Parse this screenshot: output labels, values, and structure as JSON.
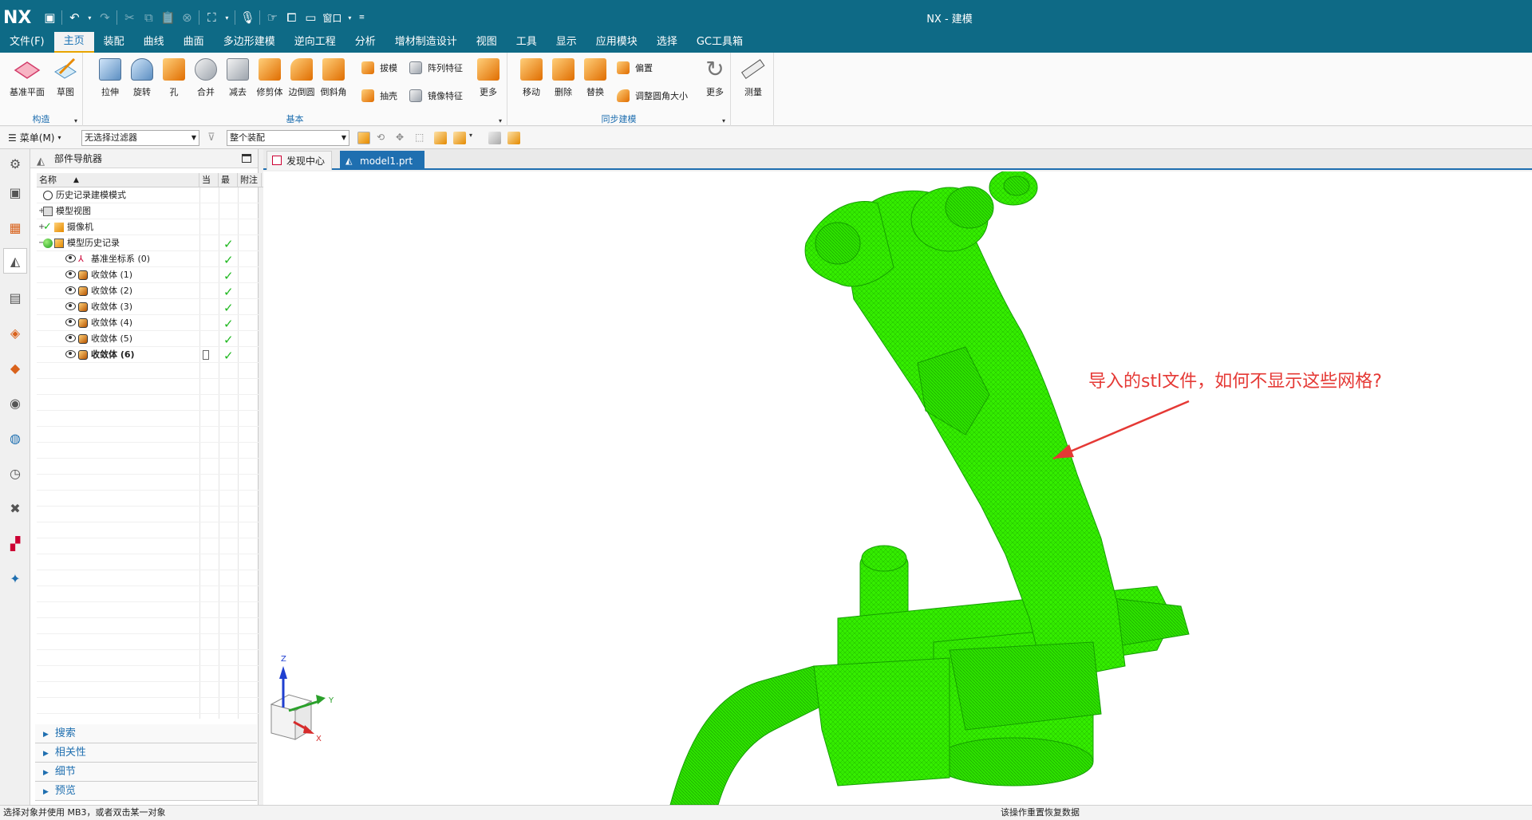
{
  "window": {
    "logo": "NX",
    "title": "NX - 建模",
    "window_menu": "窗口"
  },
  "menubar": {
    "items": [
      "文件(F)",
      "主页",
      "装配",
      "曲线",
      "曲面",
      "多边形建模",
      "逆向工程",
      "分析",
      "增材制造设计",
      "视图",
      "工具",
      "显示",
      "应用模块",
      "选择",
      "GC工具箱"
    ],
    "active_index": 1
  },
  "ribbon": {
    "construct": {
      "label": "构造",
      "buttons": [
        "基准平面",
        "草图"
      ]
    },
    "basic": {
      "label": "基本",
      "big_buttons": [
        "拉伸",
        "旋转",
        "孔",
        "合并",
        "减去",
        "修剪体",
        "边倒圆",
        "倒斜角"
      ],
      "small_buttons": [
        "拔模",
        "阵列特征",
        "抽壳",
        "镜像特征"
      ],
      "more": "更多"
    },
    "sync": {
      "label": "同步建模",
      "big_buttons": [
        "移动",
        "删除",
        "替换"
      ],
      "small_buttons": [
        "偏置",
        "调整圆角大小"
      ],
      "more": "更多"
    },
    "measure": {
      "label": "测量"
    }
  },
  "filterbar": {
    "menu": "菜单(M)",
    "filter": "无选择过滤器",
    "scope": "整个装配"
  },
  "navigator": {
    "title": "部件导航器",
    "columns": [
      "名称",
      "当",
      "最",
      "附注"
    ],
    "rows": [
      {
        "label": "历史记录建模模式",
        "level": 0,
        "check": false,
        "bold": false
      },
      {
        "label": "模型视图",
        "level": 0,
        "check": false,
        "bold": false
      },
      {
        "label": "摄像机",
        "level": 0,
        "check": false,
        "bold": false
      },
      {
        "label": "模型历史记录",
        "level": 0,
        "check": true,
        "bold": false
      },
      {
        "label": "基准坐标系 (0)",
        "level": 1,
        "check": true,
        "bold": false
      },
      {
        "label": "收敛体 (1)",
        "level": 1,
        "check": true,
        "bold": false
      },
      {
        "label": "收敛体 (2)",
        "level": 1,
        "check": true,
        "bold": false
      },
      {
        "label": "收敛体 (3)",
        "level": 1,
        "check": true,
        "bold": false
      },
      {
        "label": "收敛体 (4)",
        "level": 1,
        "check": true,
        "bold": false
      },
      {
        "label": "收敛体 (5)",
        "level": 1,
        "check": true,
        "bold": false
      },
      {
        "label": "收敛体 (6)",
        "level": 1,
        "check": true,
        "bold": true
      }
    ],
    "docked": [
      "搜索",
      "相关性",
      "细节",
      "预览"
    ]
  },
  "tabs": [
    {
      "label": "发现中心",
      "active": false
    },
    {
      "label": "model1.prt",
      "active": true
    }
  ],
  "viewport": {
    "annotation": "导入的stl文件，如何不显示这些网格?",
    "axes": {
      "z": "Z",
      "y": "Y",
      "x": "X"
    }
  },
  "status": {
    "left": "选择对象并使用 MB3，或者双击某一对象",
    "right": "该操作重置恢复数据"
  },
  "colors": {
    "accent": "#0e6a86",
    "model": "#33ee00",
    "annotation": "#e53935"
  }
}
